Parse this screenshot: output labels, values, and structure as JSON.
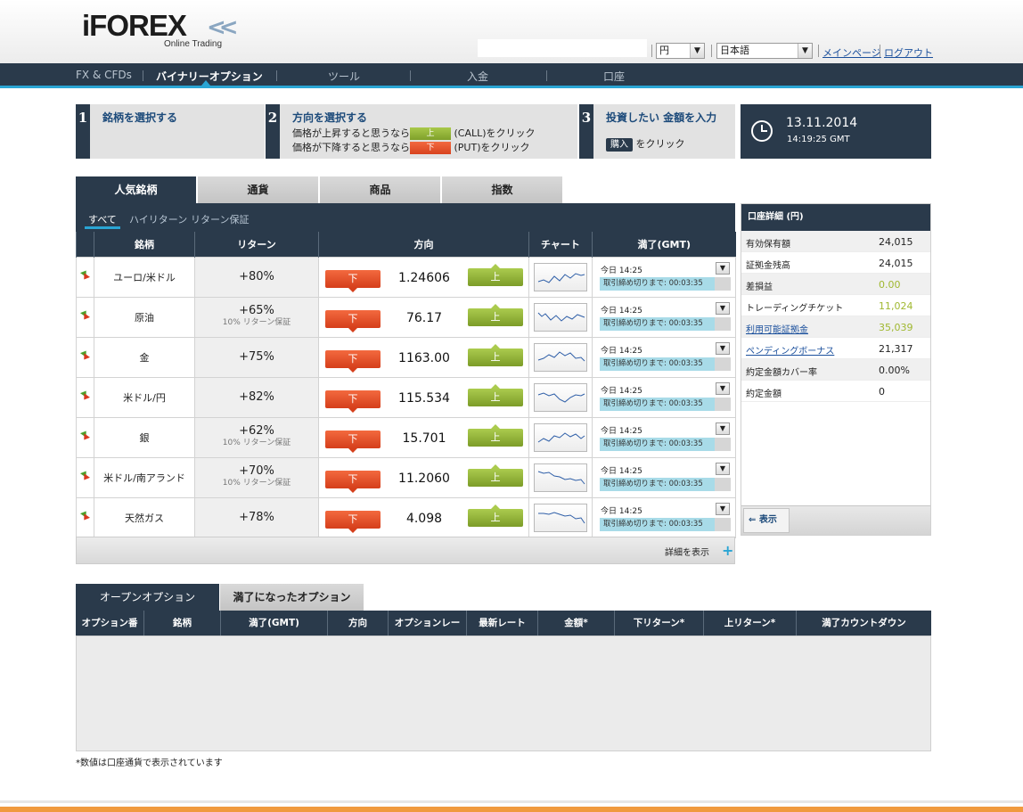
{
  "header": {
    "logo_text": "iFOREX",
    "logo_sub": "Online Trading",
    "currency": "円",
    "language": "日本語",
    "my_page": "メインページ",
    "logout": "ログアウト"
  },
  "nav": [
    "FX & CFDs",
    "バイナリーオプション",
    "ツール",
    "入金",
    "口座"
  ],
  "steps": {
    "s1": {
      "num": "1",
      "title": "銘柄を選択する"
    },
    "s2": {
      "num": "2",
      "title": "方向を選択する",
      "line1_pre": "価格が上昇すると思うなら",
      "line1_btn": "上",
      "line1_post": "(CALL)をクリック",
      "line2_pre": "価格が下降すると思うなら",
      "line2_btn": "下",
      "line2_post": "(PUT)をクリック"
    },
    "s3": {
      "num": "3",
      "title": "投資したい 金額を入力",
      "btn": "購入",
      "post": "をクリック"
    }
  },
  "clock": {
    "date": "13.11.2014",
    "time": "14:19:25 GMT"
  },
  "category_tabs": [
    "人気銘柄",
    "通貨",
    "商品",
    "指数"
  ],
  "sub_tabs": [
    "すべて",
    "ハイリターン",
    "リターン保証"
  ],
  "asset_table": {
    "headers": [
      "銘柄",
      "リターン",
      "方向",
      "チャート",
      "満了(GMT)"
    ],
    "down_label": "下",
    "up_label": "上",
    "rows": [
      {
        "name": "ユーロ/米ドル",
        "ret": "+80%",
        "guarantee": "",
        "rate": "1.24606",
        "expiry": "今日 14:25",
        "countdown": "取引締め切りまで: 00:03:35"
      },
      {
        "name": "原油",
        "ret": "+65%",
        "guarantee": "10% リターン保証",
        "rate": "76.17",
        "expiry": "今日 14:25",
        "countdown": "取引締め切りまで: 00:03:35"
      },
      {
        "name": "金",
        "ret": "+75%",
        "guarantee": "",
        "rate": "1163.00",
        "expiry": "今日 14:25",
        "countdown": "取引締め切りまで: 00:03:35"
      },
      {
        "name": "米ドル/円",
        "ret": "+82%",
        "guarantee": "",
        "rate": "115.534",
        "expiry": "今日 14:25",
        "countdown": "取引締め切りまで: 00:03:35"
      },
      {
        "name": "銀",
        "ret": "+62%",
        "guarantee": "10% リターン保証",
        "rate": "15.701",
        "expiry": "今日 14:25",
        "countdown": "取引締め切りまで: 00:03:35"
      },
      {
        "name": "米ドル/南アランド",
        "ret": "+70%",
        "guarantee": "10% リターン保証",
        "rate": "11.2060",
        "expiry": "今日 14:25",
        "countdown": "取引締め切りまで: 00:03:35"
      },
      {
        "name": "天然ガス",
        "ret": "+78%",
        "guarantee": "",
        "rate": "4.098",
        "expiry": "今日 14:25",
        "countdown": "取引締め切りまで: 00:03:35"
      }
    ],
    "more_label": "詳細を表示"
  },
  "account": {
    "title": "口座詳細 (円)",
    "rows": [
      {
        "label": "有効保有額",
        "value": "24,015",
        "link": false,
        "green": false
      },
      {
        "label": "証拠金残高",
        "value": "24,015",
        "link": false,
        "green": false
      },
      {
        "label": "差損益",
        "value": "0.00",
        "link": false,
        "green": true
      },
      {
        "label": "トレーディングチケット",
        "value": "11,024",
        "link": false,
        "green": true
      },
      {
        "label": "利用可能証拠金",
        "value": "35,039",
        "link": true,
        "green": true
      },
      {
        "label": "ペンディングボーナス",
        "value": "21,317",
        "link": true,
        "green": false
      },
      {
        "label": "約定金額カバー率",
        "value": "0.00%",
        "link": false,
        "green": false
      },
      {
        "label": "約定金額",
        "value": "0",
        "link": false,
        "green": false
      }
    ],
    "show_label": "表示"
  },
  "options": {
    "tabs": [
      "オープンオプション",
      "満了になったオプション"
    ],
    "columns": [
      "オプション番",
      "銘柄",
      "満了(GMT)",
      "方向",
      "オプションレー",
      "最新レート",
      "金額*",
      "下リターン*",
      "上リターン*",
      "満了カウントダウン"
    ],
    "footnote": "*数値は口座通貨で表示されています"
  },
  "colors": {
    "navy": "#2a3a4b",
    "accent_blue": "#2aa5d4",
    "call_green": "#8db23a",
    "put_red": "#e04f25",
    "brand_orange": "#f09a3e"
  }
}
